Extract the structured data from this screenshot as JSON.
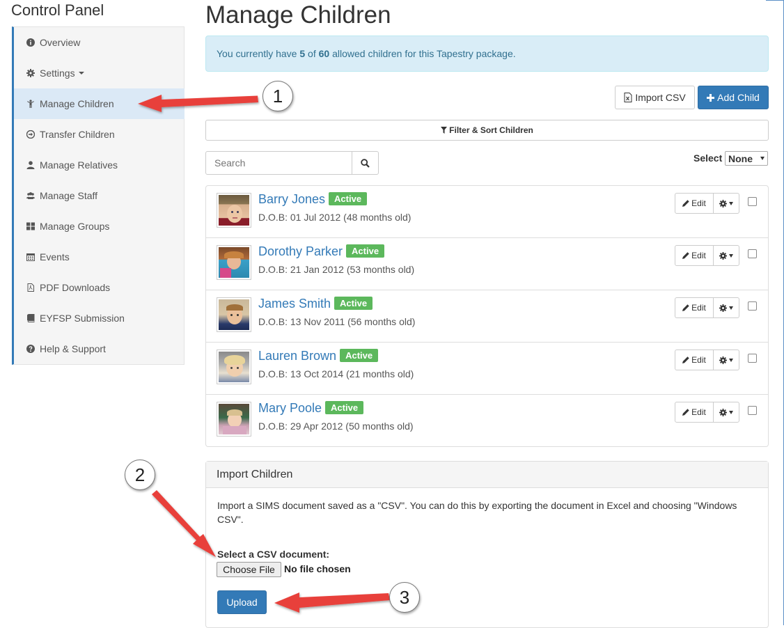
{
  "sidebar": {
    "title": "Control Panel",
    "items": [
      {
        "label": "Overview",
        "icon": "info-circle-icon"
      },
      {
        "label": "Settings",
        "icon": "gear-icon"
      },
      {
        "label": "Manage Children",
        "icon": "child-icon"
      },
      {
        "label": "Transfer Children",
        "icon": "circle-arrow-icon"
      },
      {
        "label": "Manage Relatives",
        "icon": "user-icon"
      },
      {
        "label": "Manage Staff",
        "icon": "users-icon"
      },
      {
        "label": "Manage Groups",
        "icon": "grid-icon"
      },
      {
        "label": "Events",
        "icon": "calendar-icon"
      },
      {
        "label": "PDF Downloads",
        "icon": "pdf-file-icon"
      },
      {
        "label": "EYFSP Submission",
        "icon": "book-icon"
      },
      {
        "label": "Help & Support",
        "icon": "question-circle-icon"
      }
    ],
    "active_item": "Manage Children"
  },
  "main": {
    "title": "Manage Children",
    "alert": {
      "prefix": "You currently have",
      "current": "5",
      "of": "of",
      "allowed": "60",
      "suffix": "allowed children for this Tapestry package."
    },
    "import_csv_label": "Import CSV",
    "add_child_label": "Add Child",
    "filter_label": "Filter & Sort Children",
    "search_placeholder": "Search",
    "select_label": "Select",
    "select_value": "None",
    "children": [
      {
        "name": "Barry Jones",
        "status": "Active",
        "dob": "D.O.B: 01 Jul 2012 (48 months old)"
      },
      {
        "name": "Dorothy Parker",
        "status": "Active",
        "dob": "D.O.B: 21 Jan 2012 (53 months old)"
      },
      {
        "name": "James Smith",
        "status": "Active",
        "dob": "D.O.B: 13 Nov 2011 (56 months old)"
      },
      {
        "name": "Lauren Brown",
        "status": "Active",
        "dob": "D.O.B: 13 Oct 2014 (21 months old)"
      },
      {
        "name": "Mary Poole",
        "status": "Active",
        "dob": "D.O.B: 29 Apr 2012 (50 months old)"
      }
    ],
    "edit_label": "Edit",
    "import_panel": {
      "heading": "Import Children",
      "text": "Import a SIMS document saved as a \"CSV\". You can do this by exporting the document in Excel and choosing \"Windows CSV\".",
      "file_label": "Select a CSV document:",
      "choose_file_label": "Choose File",
      "no_file_text": "No file chosen",
      "upload_label": "Upload"
    }
  },
  "annotations": {
    "callout_1": "1",
    "callout_2": "2",
    "callout_3": "3"
  },
  "colors": {
    "primary": "#337ab7",
    "success": "#5cb85c",
    "info_bg": "#d9edf7",
    "info_text": "#31708f",
    "arrow": "#e8403a"
  }
}
